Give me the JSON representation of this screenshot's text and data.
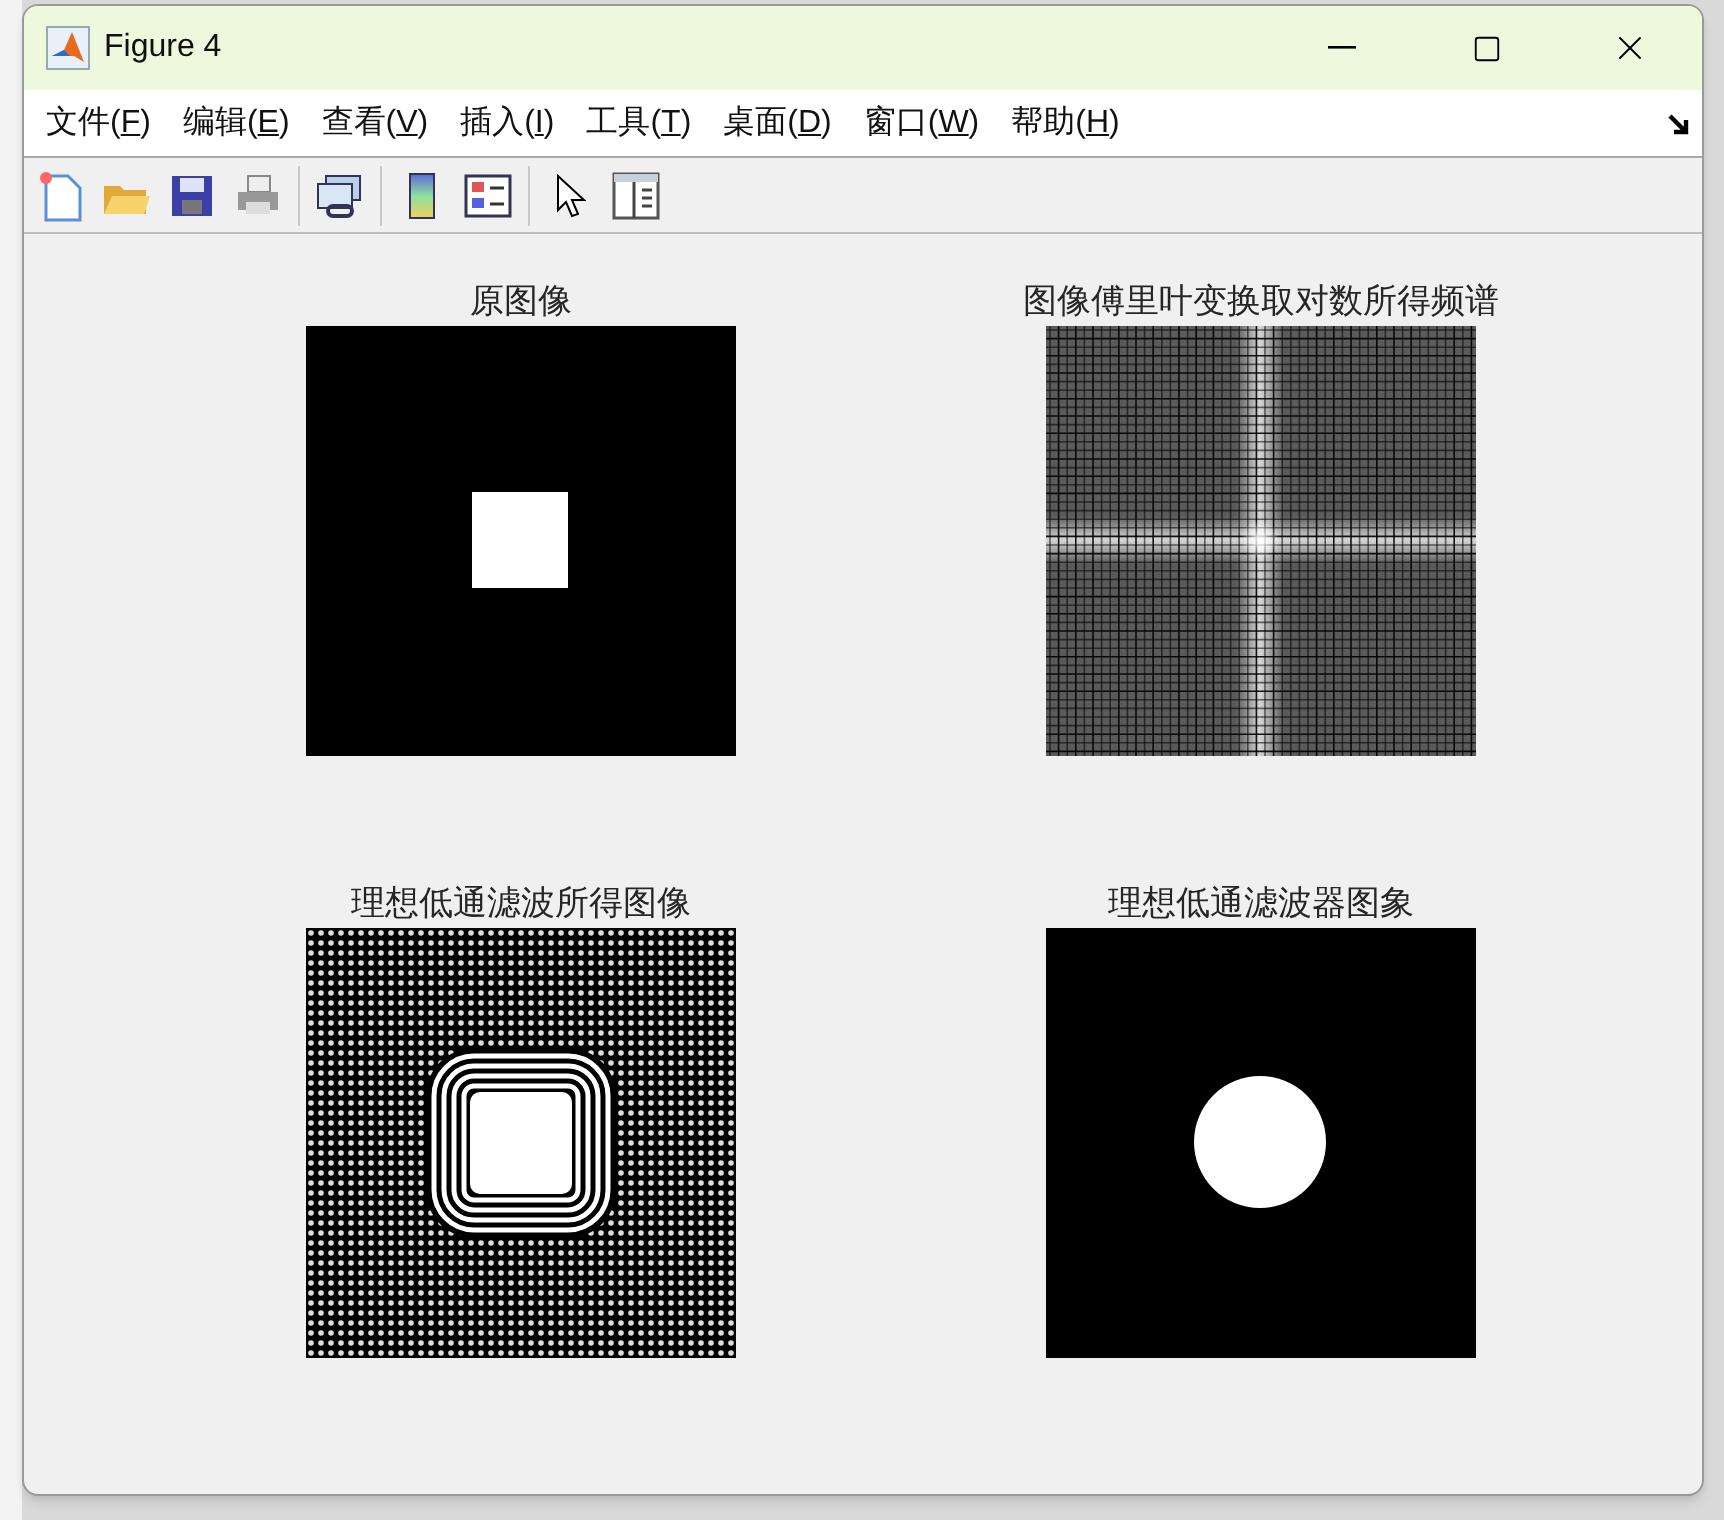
{
  "window": {
    "title": "Figure 4"
  },
  "menu": [
    {
      "label": "文件(",
      "key": "F",
      "tail": ")"
    },
    {
      "label": "编辑(",
      "key": "E",
      "tail": ")"
    },
    {
      "label": "查看(",
      "key": "V",
      "tail": ")"
    },
    {
      "label": "插入(",
      "key": "I",
      "tail": ")"
    },
    {
      "label": "工具(",
      "key": "T",
      "tail": ")"
    },
    {
      "label": "桌面(",
      "key": "D",
      "tail": ")"
    },
    {
      "label": "窗口(",
      "key": "W",
      "tail": ")"
    },
    {
      "label": "帮助(",
      "key": "H",
      "tail": ")"
    }
  ],
  "plots": [
    {
      "title": "原图像",
      "kind": "square"
    },
    {
      "title": "图像傅里叶变换取对数所得频谱",
      "kind": "spectrum"
    },
    {
      "title": "理想低通滤波所得图像",
      "kind": "filtered"
    },
    {
      "title": "理想低通滤波器图象",
      "kind": "filter"
    }
  ]
}
